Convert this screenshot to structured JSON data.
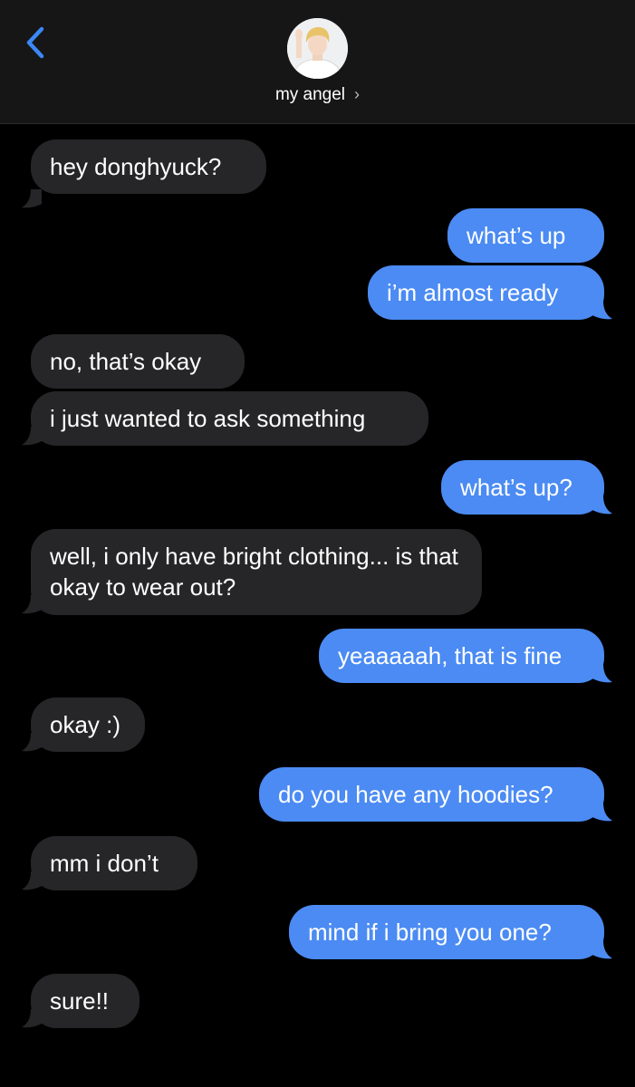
{
  "header": {
    "back_icon": "chevron-left-icon",
    "contact_name": "my angel",
    "chevron": "›",
    "accent_color": "#3b87f5"
  },
  "colors": {
    "incoming_bubble": "#262628",
    "outgoing_bubble": "#4b8bf3",
    "background": "#000000",
    "header_background": "#161616"
  },
  "messages": [
    {
      "from": "them",
      "text": "hey donghyuck?"
    },
    {
      "from": "me",
      "text": "what’s up"
    },
    {
      "from": "me",
      "text": "i’m almost ready"
    },
    {
      "from": "them",
      "text": "no, that’s okay"
    },
    {
      "from": "them",
      "text": "i just wanted to ask something"
    },
    {
      "from": "me",
      "text": "what’s up?"
    },
    {
      "from": "them",
      "text": "well, i only have bright clothing... is that okay to wear out?"
    },
    {
      "from": "me",
      "text": "yeaaaaah, that is fine"
    },
    {
      "from": "them",
      "text": "okay :)"
    },
    {
      "from": "me",
      "text": "do you have any hoodies?"
    },
    {
      "from": "them",
      "text": "mm i don’t"
    },
    {
      "from": "me",
      "text": "mind if i bring you one?"
    },
    {
      "from": "them",
      "text": "sure!!"
    }
  ]
}
